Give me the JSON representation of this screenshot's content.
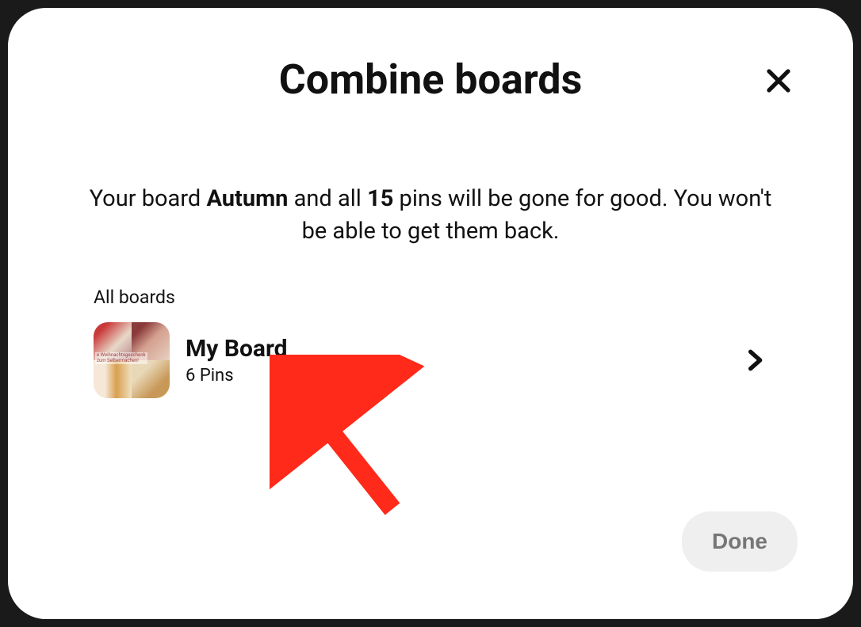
{
  "modal": {
    "title": "Combine boards",
    "warning": {
      "prefix": "Your board ",
      "board_name": "Autumn",
      "middle": " and all ",
      "pin_count": "15",
      "suffix": " pins will be gone for good. You won't be able to get them back."
    },
    "section_label": "All boards",
    "boards": [
      {
        "name": "My Board",
        "pins_label": "6 Pins"
      }
    ],
    "done_label": "Done"
  }
}
